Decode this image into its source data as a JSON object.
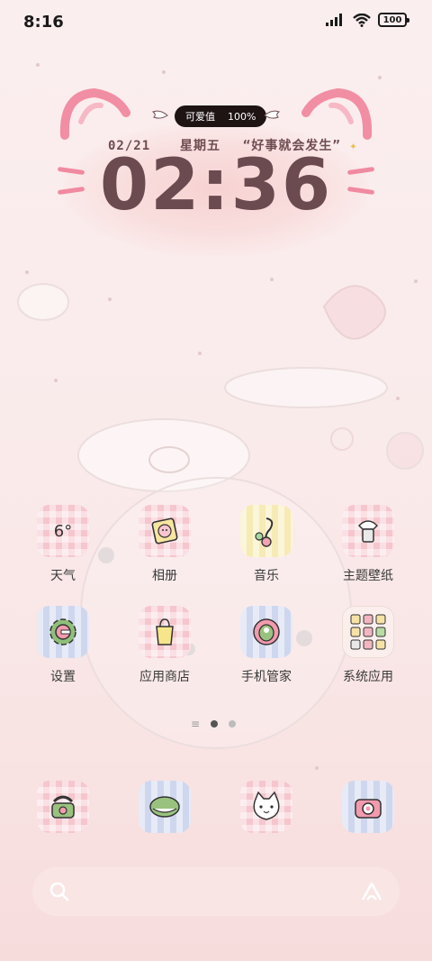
{
  "status_bar": {
    "time": "8:16",
    "battery": "100"
  },
  "clock_widget": {
    "badge_label": "可爱值",
    "badge_value": "100%",
    "date": "02/21",
    "weekday": "星期五",
    "slogan": "“好事就会发生”",
    "time": "02:36"
  },
  "apps": [
    {
      "label": "天气",
      "icon": "weather-icon",
      "icon_text": "6°"
    },
    {
      "label": "相册",
      "icon": "gallery-icon"
    },
    {
      "label": "音乐",
      "icon": "music-icon"
    },
    {
      "label": "主题壁纸",
      "icon": "theme-icon"
    },
    {
      "label": "设置",
      "icon": "settings-icon"
    },
    {
      "label": "应用商店",
      "icon": "app-store-icon"
    },
    {
      "label": "手机管家",
      "icon": "security-icon"
    },
    {
      "label": "系统应用",
      "icon": "folder-icon"
    }
  ],
  "page_indicator": {
    "pages": 2,
    "active": 1
  },
  "dock": [
    {
      "icon": "phone-icon"
    },
    {
      "icon": "messages-icon"
    },
    {
      "icon": "browser-cat-icon"
    },
    {
      "icon": "camera-icon"
    }
  ],
  "colors": {
    "accent_pink": "#f08aa0",
    "clock_text": "#6b4a50",
    "background": "#fbeeee"
  }
}
